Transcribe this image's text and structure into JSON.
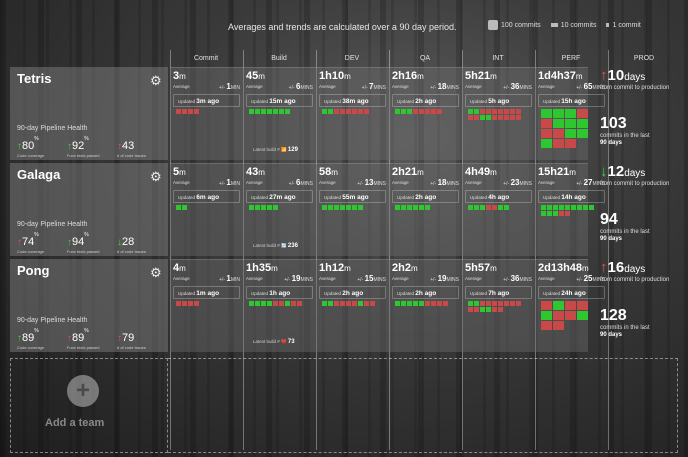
{
  "header": {
    "headline": "Averages and trends are calculated over a 90 day period.",
    "legend": [
      {
        "label": "100 commits",
        "size": "big"
      },
      {
        "label": "10 commits",
        "size": "med"
      },
      {
        "label": "1 commit",
        "size": "small"
      }
    ]
  },
  "stages": [
    "Commit",
    "Build",
    "DEV",
    "QA",
    "INT",
    "PERF",
    "PROD"
  ],
  "labels": {
    "average": "Average",
    "plusminus": "+/-",
    "updated": "Updated",
    "health_title": "90-day Pipeline Health",
    "latest_build": "Latest build #",
    "from_commit": "from commit to production",
    "commits_in": "commits in the last",
    "ninety_days": "90 days",
    "add_team": "Add a team"
  },
  "teams": [
    {
      "name": "Tetris",
      "health": [
        {
          "arrow": "↑",
          "color": "up-g",
          "value": "80",
          "unit": "%",
          "label": "Code coverage"
        },
        {
          "arrow": "↑",
          "color": "up-g",
          "value": "92",
          "unit": "%",
          "label": "Func tests passed"
        },
        {
          "arrow": "↑",
          "color": "up-r",
          "value": "43",
          "unit": "",
          "label": "# of code issues"
        }
      ],
      "cells": [
        {
          "avg_main": "3",
          "avg_unit": "m",
          "pm_val": "1",
          "pm_unit": "MIN",
          "updated": "3m ago",
          "blocks": [
            "r",
            "r",
            "r",
            "r"
          ]
        },
        {
          "avg_main": "45",
          "avg_unit": "m",
          "pm_val": "6",
          "pm_unit": "MINS",
          "updated": "15m ago",
          "blocks": [
            "g",
            "g",
            "g",
            "g",
            "g",
            "g",
            "g"
          ],
          "latest_icon": "📶",
          "latest": "129"
        },
        {
          "avg_main": "1h10",
          "avg_unit": "m",
          "pm_val": "7",
          "pm_unit": "MINS",
          "updated": "38m ago",
          "blocks": [
            "g",
            "g",
            "r",
            "r",
            "r",
            "r",
            "r",
            "r"
          ]
        },
        {
          "avg_main": "2h16",
          "avg_unit": "m",
          "pm_val": "18",
          "pm_unit": "MINS",
          "updated": "2h ago",
          "blocks": [
            "g",
            "g",
            "g",
            "r",
            "r",
            "r",
            "r",
            "r"
          ]
        },
        {
          "avg_main": "5h21",
          "avg_unit": "m",
          "pm_val": "36",
          "pm_unit": "MINS",
          "updated": "5h ago",
          "blocks": [
            "g",
            "g",
            "r",
            "r",
            "r",
            "r",
            "r",
            "r",
            "r",
            "r",
            "r",
            "g",
            "g",
            "r",
            "r",
            "r",
            "r",
            "r"
          ]
        },
        {
          "avg_main": "1d4h37",
          "avg_unit": "m",
          "pm_val": "65",
          "pm_unit": "MINS",
          "updated": "15h ago",
          "blocks": [
            "G",
            "G",
            "G",
            "R",
            "R",
            "G",
            "G",
            "G",
            "R",
            "R",
            "G",
            "G",
            "G",
            "R",
            "R"
          ]
        }
      ],
      "prod": {
        "arrow": "↑",
        "arrow_color": "ar-r",
        "days": "10",
        "commits": "103"
      }
    },
    {
      "name": "Galaga",
      "health": [
        {
          "arrow": "↑",
          "color": "up-r",
          "value": "74",
          "unit": "%",
          "label": "Code coverage"
        },
        {
          "arrow": "↑",
          "color": "up-g",
          "value": "94",
          "unit": "%",
          "label": "Func tests passed"
        },
        {
          "arrow": "↓",
          "color": "dn-g",
          "value": "28",
          "unit": "",
          "label": "# of code issues"
        }
      ],
      "cells": [
        {
          "avg_main": "5",
          "avg_unit": "m",
          "pm_val": "1",
          "pm_unit": "MIN",
          "updated": "6m ago",
          "blocks": [
            "g",
            "g"
          ]
        },
        {
          "avg_main": "43",
          "avg_unit": "m",
          "pm_val": "6",
          "pm_unit": "MINS",
          "updated": "27m ago",
          "blocks": [
            "g",
            "g",
            "g",
            "g",
            "g"
          ],
          "latest_icon": "🔄",
          "latest": "236"
        },
        {
          "avg_main": "58",
          "avg_unit": "m",
          "pm_val": "13",
          "pm_unit": "MINS",
          "updated": "55m ago",
          "blocks": [
            "g",
            "g",
            "g",
            "g",
            "g",
            "g",
            "g"
          ]
        },
        {
          "avg_main": "2h21",
          "avg_unit": "m",
          "pm_val": "18",
          "pm_unit": "MINS",
          "updated": "2h ago",
          "blocks": [
            "g",
            "g",
            "g",
            "g",
            "g",
            "g"
          ]
        },
        {
          "avg_main": "4h49",
          "avg_unit": "m",
          "pm_val": "23",
          "pm_unit": "MINS",
          "updated": "4h ago",
          "blocks": [
            "g",
            "g",
            "g",
            "r",
            "r",
            "g",
            "g"
          ]
        },
        {
          "avg_main": "15h21",
          "avg_unit": "m",
          "pm_val": "27",
          "pm_unit": "MINS",
          "updated": "14h ago",
          "blocks": [
            "g",
            "g",
            "g",
            "g",
            "g",
            "g",
            "g",
            "g",
            "g",
            "g",
            "g",
            "g",
            "r",
            "r"
          ]
        }
      ],
      "prod": {
        "arrow": "↓",
        "arrow_color": "ar-g",
        "days": "12",
        "commits": "94"
      }
    },
    {
      "name": "Pong",
      "health": [
        {
          "arrow": "↑",
          "color": "up-g",
          "value": "89",
          "unit": "%",
          "label": "Code coverage"
        },
        {
          "arrow": "↑",
          "color": "up-r",
          "value": "89",
          "unit": "%",
          "label": "Func tests passed"
        },
        {
          "arrow": "↑",
          "color": "up-r",
          "value": "79",
          "unit": "",
          "label": "# of code issues"
        }
      ],
      "cells": [
        {
          "avg_main": "4",
          "avg_unit": "m",
          "pm_val": "1",
          "pm_unit": "MIN",
          "updated": "1m ago",
          "blocks": [
            "r",
            "r",
            "r",
            "r"
          ]
        },
        {
          "avg_main": "1h35",
          "avg_unit": "m",
          "pm_val": "19",
          "pm_unit": "MINS",
          "updated": "1h ago",
          "blocks": [
            "g",
            "g",
            "g",
            "g",
            "r",
            "r",
            "g",
            "r",
            "r"
          ],
          "latest_icon": "💔",
          "latest": "73"
        },
        {
          "avg_main": "1h12",
          "avg_unit": "m",
          "pm_val": "15",
          "pm_unit": "MINS",
          "updated": "2h ago",
          "blocks": [
            "g",
            "g",
            "r",
            "r",
            "r",
            "r",
            "g",
            "r",
            "r"
          ]
        },
        {
          "avg_main": "2h2",
          "avg_unit": "m",
          "pm_val": "19",
          "pm_unit": "MINS",
          "updated": "2h ago",
          "blocks": [
            "g",
            "g",
            "g",
            "g",
            "g",
            "r",
            "r",
            "r",
            "r"
          ]
        },
        {
          "avg_main": "5h57",
          "avg_unit": "m",
          "pm_val": "36",
          "pm_unit": "MINS",
          "updated": "7h ago",
          "blocks": [
            "g",
            "g",
            "r",
            "r",
            "r",
            "r",
            "r",
            "r",
            "r",
            "r",
            "r",
            "g",
            "g",
            "r",
            "r"
          ]
        },
        {
          "avg_main": "2d13h48",
          "avg_unit": "m",
          "pm_val": "25",
          "pm_unit": "MINS",
          "updated": "24h ago",
          "blocks": [
            "R",
            "G",
            "R",
            "R",
            "G",
            "R",
            "R",
            "G",
            "R",
            "R"
          ]
        }
      ],
      "prod": {
        "arrow": "↑",
        "arrow_color": "ar-r",
        "days": "16",
        "commits": "128"
      }
    }
  ]
}
